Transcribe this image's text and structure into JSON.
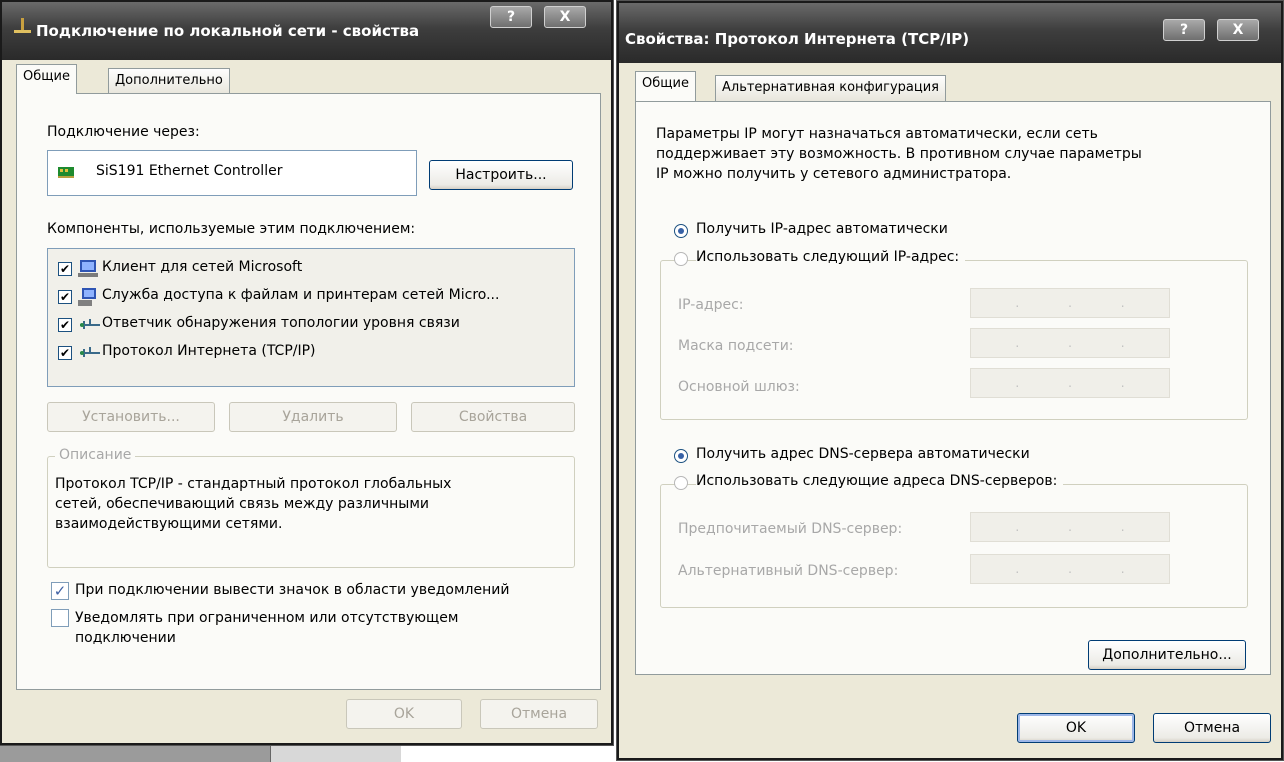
{
  "left_window": {
    "title": "Подключение по локальной сети - свойства",
    "help_btn": "?",
    "close_btn": "X",
    "tabs": [
      {
        "label": "Общие",
        "active": true
      },
      {
        "label": "Дополнительно",
        "active": false
      }
    ],
    "connect_via_label": "Подключение через:",
    "adapter_name": "SiS191 Ethernet Controller",
    "configure_btn": "Настроить...",
    "components_label": "Компоненты, используемые этим подключением:",
    "components": [
      {
        "label": "Клиент для сетей Microsoft",
        "checked": true,
        "icon": "network-client-icon"
      },
      {
        "label": "Служба доступа к файлам и принтерам сетей Micro...",
        "checked": true,
        "icon": "file-printer-share-icon"
      },
      {
        "label": "Ответчик обнаружения топологии уровня связи",
        "checked": true,
        "icon": "protocol-icon"
      },
      {
        "label": "Протокол Интернета (TCP/IP)",
        "checked": true,
        "icon": "protocol-icon"
      }
    ],
    "install_btn": "Установить...",
    "remove_btn": "Удалить",
    "properties_btn": "Свойства",
    "description_label": "Описание",
    "description_lines": [
      "Протокол TCP/IP - стандартный протокол глобальных",
      "сетей, обеспечивающий связь между различными",
      "взаимодействующими сетями."
    ],
    "show_icon_label": "При подключении вывести значок в области уведомлений",
    "show_icon_checked": true,
    "notify_label_1": "Уведомлять при ограниченном или отсутствующем",
    "notify_label_2": "подключении",
    "notify_checked": false,
    "ok_btn": "OK",
    "cancel_btn": "Отмена"
  },
  "right_window": {
    "title": "Свойства: Протокол Интернета (TCP/IP)",
    "help_btn": "?",
    "close_btn": "X",
    "tabs": [
      {
        "label": "Общие",
        "active": true
      },
      {
        "label": "Альтернативная конфигурация",
        "active": false
      }
    ],
    "intro_lines": [
      "Параметры IP могут назначаться автоматически, если сеть",
      "поддерживает эту возможность. В противном случае параметры",
      "IP можно получить у сетевого администратора."
    ],
    "ip_auto_label": "Получить IP-адрес автоматически",
    "ip_manual_label": "Использовать следующий IP-адрес:",
    "ip_address_label": "IP-адрес:",
    "subnet_label": "Маска подсети:",
    "gateway_label": "Основной шлюз:",
    "dns_auto_label": "Получить адрес DNS-сервера автоматически",
    "dns_manual_label": "Использовать следующие адреса DNS-серверов:",
    "dns_preferred_label": "Предпочитаемый DNS-сервер:",
    "dns_alternate_label": "Альтернативный DNS-сервер:",
    "advanced_btn": "Дополнительно...",
    "ok_btn": "OK",
    "cancel_btn": "Отмена"
  },
  "colors": {
    "dialog_bg": "#ece9d8",
    "title_bar": "#3e3e3e",
    "button_border": "#003c74",
    "disabled_text": "#a8a8a8"
  }
}
